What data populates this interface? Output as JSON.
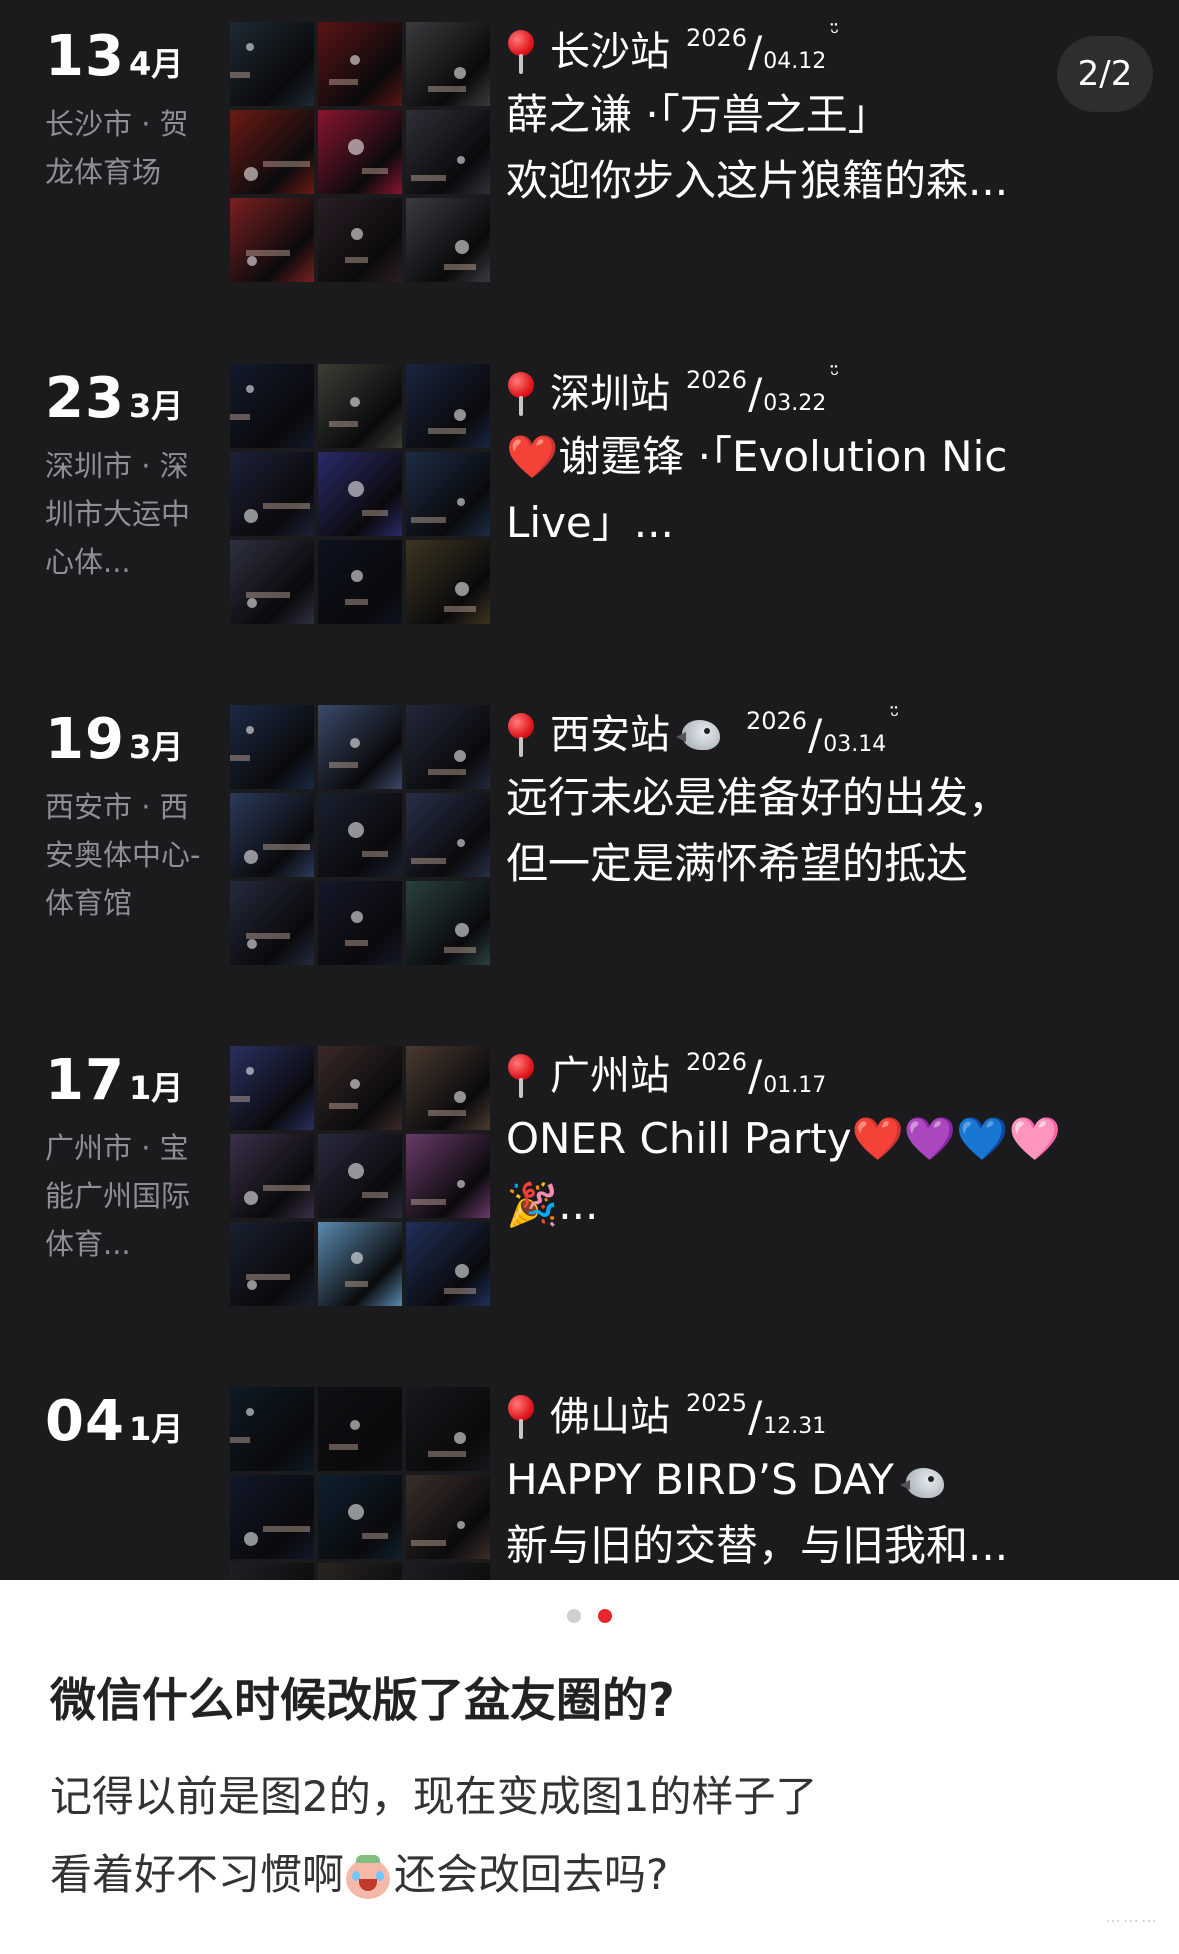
{
  "pager": "2/2",
  "entries": [
    {
      "day": "13",
      "month": "4月",
      "place": "长沙市 · 贺龙体育场",
      "station": "长沙站",
      "year": "2026",
      "md": "04.12",
      "has_bird": false,
      "smile": "ᵕ̈",
      "lines": [
        "薛之谦 ·「万兽之王」",
        "欢迎你步入这片狼籍的森..."
      ],
      "thumb_colors": [
        "#1e2a33",
        "#5a1414",
        "#3b3b3e",
        "#6b1b14",
        "#8a1530",
        "#2f2f38",
        "#7a2020",
        "#2b1e25",
        "#3a3a40"
      ]
    },
    {
      "day": "23",
      "month": "3月",
      "place": "深圳市 · 深圳市大运中心体...",
      "station": "深圳站",
      "year": "2026",
      "md": "03.22",
      "has_bird": false,
      "smile": "ᵕ̈",
      "lines": [
        "❤️谢霆锋 ·「Evolution Nic",
        "Live」..."
      ],
      "thumb_colors": [
        "#141a2c",
        "#3a3f35",
        "#1a2540",
        "#1d2138",
        "#2a2a6a",
        "#1c2c44",
        "#2e3040",
        "#0e1220",
        "#3d3520"
      ]
    },
    {
      "day": "19",
      "month": "3月",
      "place": "西安市 · 西安奥体中心-体育馆",
      "station": "西安站",
      "year": "2026",
      "md": "03.14",
      "has_bird": true,
      "smile": "ᵕ̈",
      "lines": [
        "远行未必是准备好的出发，",
        "但一定是满怀希望的抵达"
      ],
      "thumb_colors": [
        "#1b2a44",
        "#3a4a6a",
        "#23283a",
        "#2a3a5a",
        "#1a2030",
        "#283048",
        "#252a3c",
        "#15182a",
        "#2a4040"
      ]
    },
    {
      "day": "17",
      "month": "1月",
      "place": "广州市 · 宝能广州国际体育...",
      "station": "广州站",
      "year": "2026",
      "md": "01.17",
      "has_bird": false,
      "smile": "",
      "lines": [
        "ONER Chill Party❤️💜💙🩷",
        "🎉..."
      ],
      "thumb_colors": [
        "#2a3060",
        "#3a2a28",
        "#4a3a30",
        "#3a3048",
        "#2a2a40",
        "#6a3a6a",
        "#1a2030",
        "#5a8ab0",
        "#20305a"
      ]
    },
    {
      "day": "04",
      "month": "1月",
      "place": "",
      "station": "佛山站",
      "year": "2025",
      "md": "12.31",
      "has_bird": false,
      "smile": "",
      "lines": [
        "HAPPY BIRD’S DAY",
        "新与旧的交替，与旧我和..."
      ],
      "thumb_colors": [
        "#0e1a24",
        "#101014",
        "#18181c",
        "#12182a",
        "#0e2030",
        "#3a2e2a",
        "#202024",
        "#2a2622",
        "#1e1e22"
      ]
    }
  ],
  "post": {
    "title": "微信什么时候改版了盆友圈的?",
    "line1": "记得以前是图2的，现在变成图1的样子了",
    "line2a": "看着好不习惯啊",
    "line2b": "还会改回去吗?"
  },
  "colors": {
    "dark_bg": "#1b1b1d",
    "dot_active": "#e8242e",
    "dot_inactive": "#d0d0d0"
  }
}
